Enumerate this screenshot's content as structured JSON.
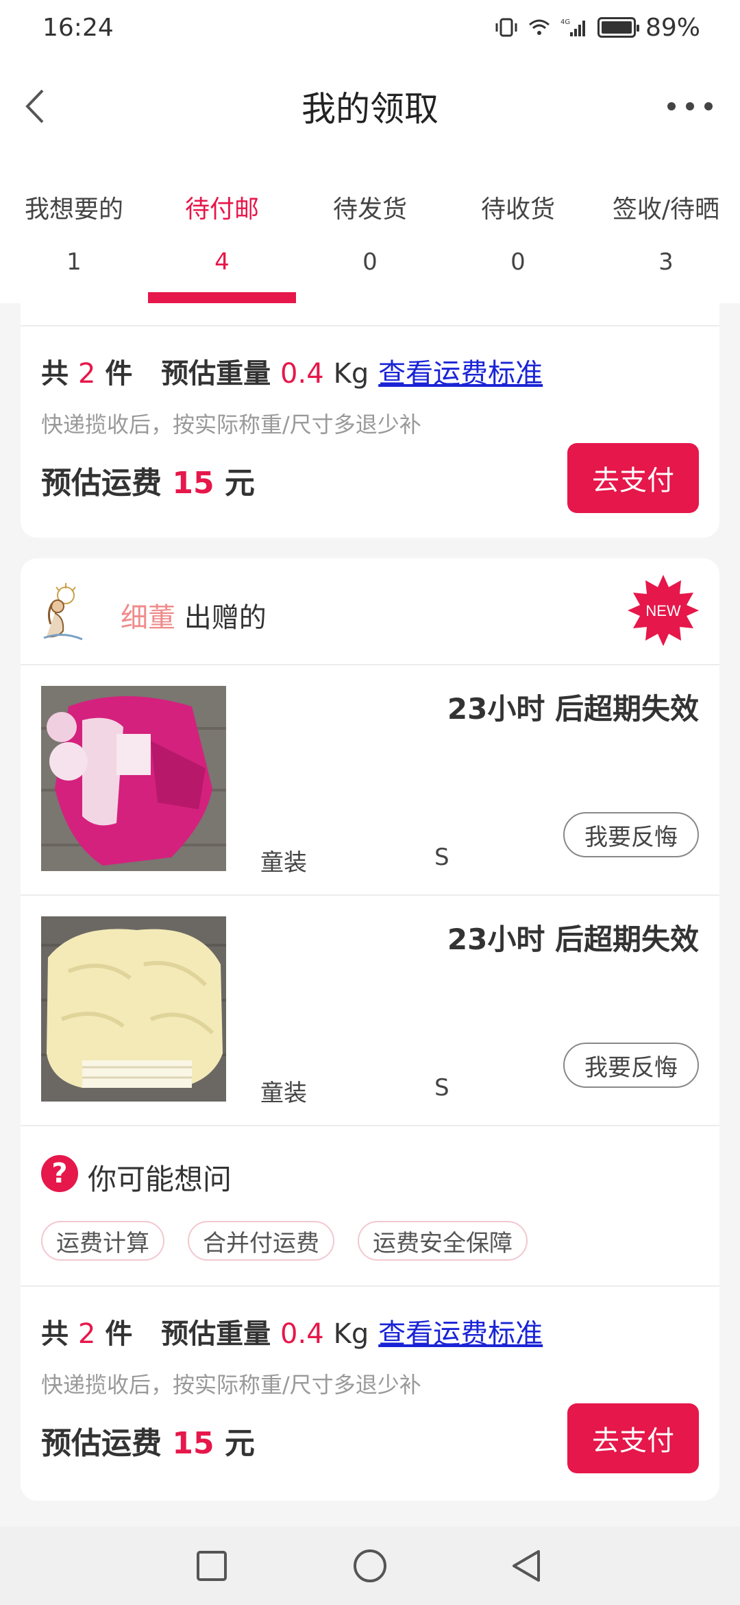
{
  "status_bar": {
    "time": "16:24",
    "signal_label": "4G",
    "battery": "89%"
  },
  "nav": {
    "title": "我的领取",
    "back_icon": "chevron-left-icon",
    "more_icon": "more-dots-icon"
  },
  "tabs": [
    {
      "label": "我想要的",
      "count": "1"
    },
    {
      "label": "待付邮",
      "count": "4",
      "active": true
    },
    {
      "label": "待发货",
      "count": "0"
    },
    {
      "label": "待收货",
      "count": "0"
    },
    {
      "label": "签收/待晒",
      "count": "3"
    }
  ],
  "top_summary": {
    "total_prefix": "共",
    "total_count": "2",
    "total_suffix": "件",
    "weight_label": "预估重量",
    "weight_value": "0.4",
    "weight_unit": "Kg",
    "link": "查看运费标准",
    "note": "快递揽收后，按实际称重/尺寸多退少补",
    "fee_label": "预估运费",
    "fee_value": "15",
    "fee_unit": "元",
    "pay_button": "去支付"
  },
  "giver": {
    "name": "细董",
    "suffix": "出赠的",
    "badge": "NEW"
  },
  "items": [
    {
      "expire": "23小时 后超期失效",
      "category": "童装",
      "size": "S",
      "button": "我要反悔",
      "image": "pink-kids-jacket"
    },
    {
      "expire": "23小时 后超期失效",
      "category": "童装",
      "size": "S",
      "button": "我要反悔",
      "image": "yellow-kids-pants"
    }
  ],
  "faq": {
    "icon": "question-icon",
    "title": "你可能想问",
    "chips": [
      "运费计算",
      "合并付运费",
      "运费安全保障"
    ]
  },
  "bottom_summary": {
    "total_prefix": "共",
    "total_count": "2",
    "total_suffix": "件",
    "weight_label": "预估重量",
    "weight_value": "0.4",
    "weight_unit": "Kg",
    "link": "查看运费标准",
    "note": "快递揽收后，按实际称重/尺寸多退少补",
    "fee_label": "预估运费",
    "fee_value": "15",
    "fee_unit": "元",
    "pay_button": "去支付"
  },
  "system_nav": [
    "square-icon",
    "circle-icon",
    "triangle-back-icon"
  ],
  "colors": {
    "accent": "#e6174a",
    "link": "#1a24d6",
    "giver_name": "#f08b8b"
  }
}
